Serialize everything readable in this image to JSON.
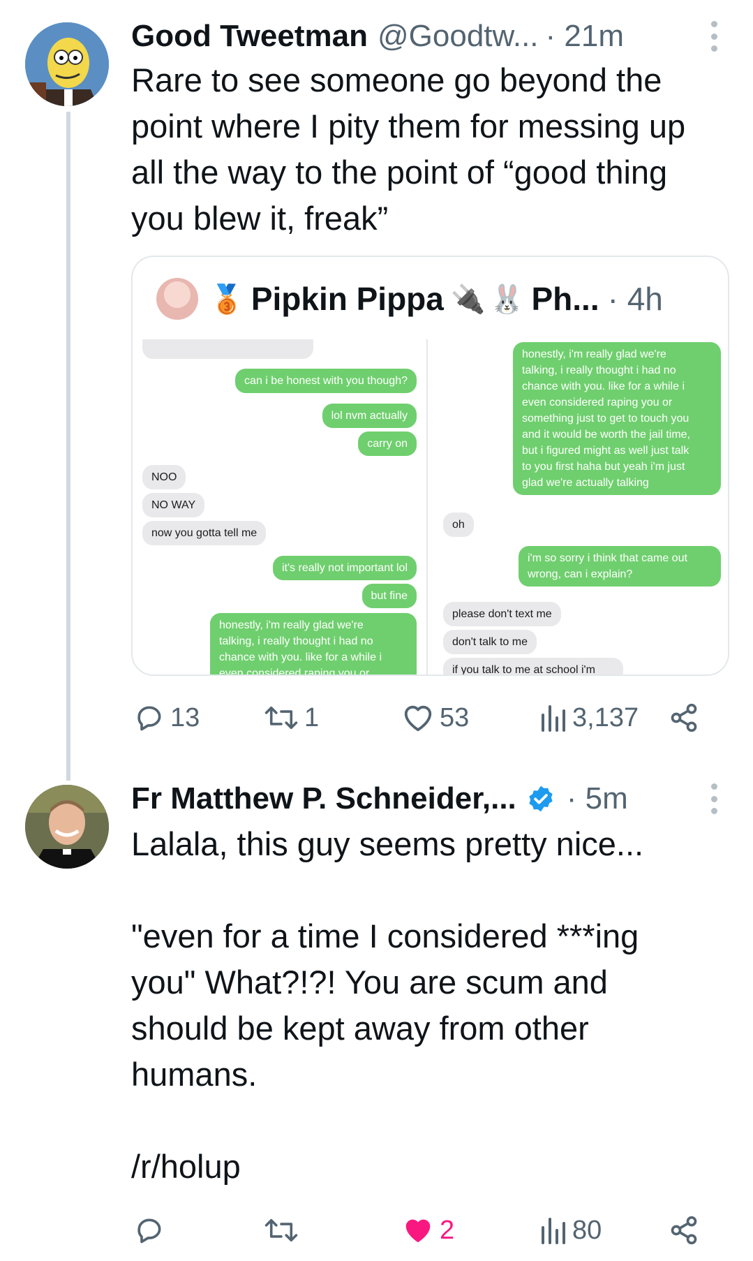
{
  "tweet1": {
    "name": "Good Tweetman",
    "handle": "@Goodtw...",
    "time": "· 21m",
    "text": "Rare to see someone go beyond the\npoint where I pity them for messing up\nall the way to the point of “good thing\nyou blew it, freak”",
    "quote": {
      "name": "Pipkin Pippa",
      "name_suffix": "Ph...",
      "time": "· 4h",
      "medal_emoji": "🥉",
      "plug_emoji": "🔌",
      "bunny_emoji": "🐰",
      "left_chat": [
        {
          "dir": "out",
          "text": "can i be honest with you though?"
        },
        {
          "dir": "out",
          "text": "lol nvm actually"
        },
        {
          "dir": "out",
          "text": "carry on"
        },
        {
          "dir": "in",
          "text": "NOO"
        },
        {
          "dir": "in",
          "text": "NO WAY"
        },
        {
          "dir": "in",
          "text": "now you gotta tell me"
        },
        {
          "dir": "out",
          "text": "it's really not important lol"
        },
        {
          "dir": "out",
          "text": "but fine"
        },
        {
          "dir": "out",
          "text": "honestly, i'm really glad we're\ntalking, i really thought i had no\nchance with you. like for a while i\neven considered raping you or"
        }
      ],
      "right_chat": [
        {
          "dir": "out",
          "text": "honestly, i'm really glad we're\ntalking, i really thought i had no\nchance with you. like for a while i\neven considered raping you or\nsomething just to get to touch you\nand it would be worth the jail time,\nbut i figured might as well just talk\nto you first haha but yeah i'm just\nglad we're actually talking"
        },
        {
          "dir": "in",
          "text": "oh"
        },
        {
          "dir": "out",
          "text": "i'm so sorry i think that came out\nwrong, can i explain?"
        },
        {
          "dir": "in",
          "text": "please don't text me"
        },
        {
          "dir": "in",
          "text": "don't talk to me"
        },
        {
          "dir": "in",
          "text": "if you talk to me at school i'm"
        }
      ]
    },
    "stats": {
      "replies": "13",
      "retweets": "1",
      "likes": "53",
      "views": "3,137"
    }
  },
  "tweet2": {
    "name": "Fr Matthew P. Schneider,...",
    "time": "· 5m",
    "verified": true,
    "text": "Lalala, this guy seems pretty nice...\n\n\"even for a time I considered ***ing\nyou\" What?!?! You are scum and\nshould be kept away from other\nhumans.\n\n/r/holup",
    "stats": {
      "likes": "2",
      "views": "80"
    }
  },
  "colors": {
    "accent_like": "#f91880",
    "verified": "#1d9bf0",
    "muted": "#536471",
    "imessage_green": "#6fcf6e"
  }
}
